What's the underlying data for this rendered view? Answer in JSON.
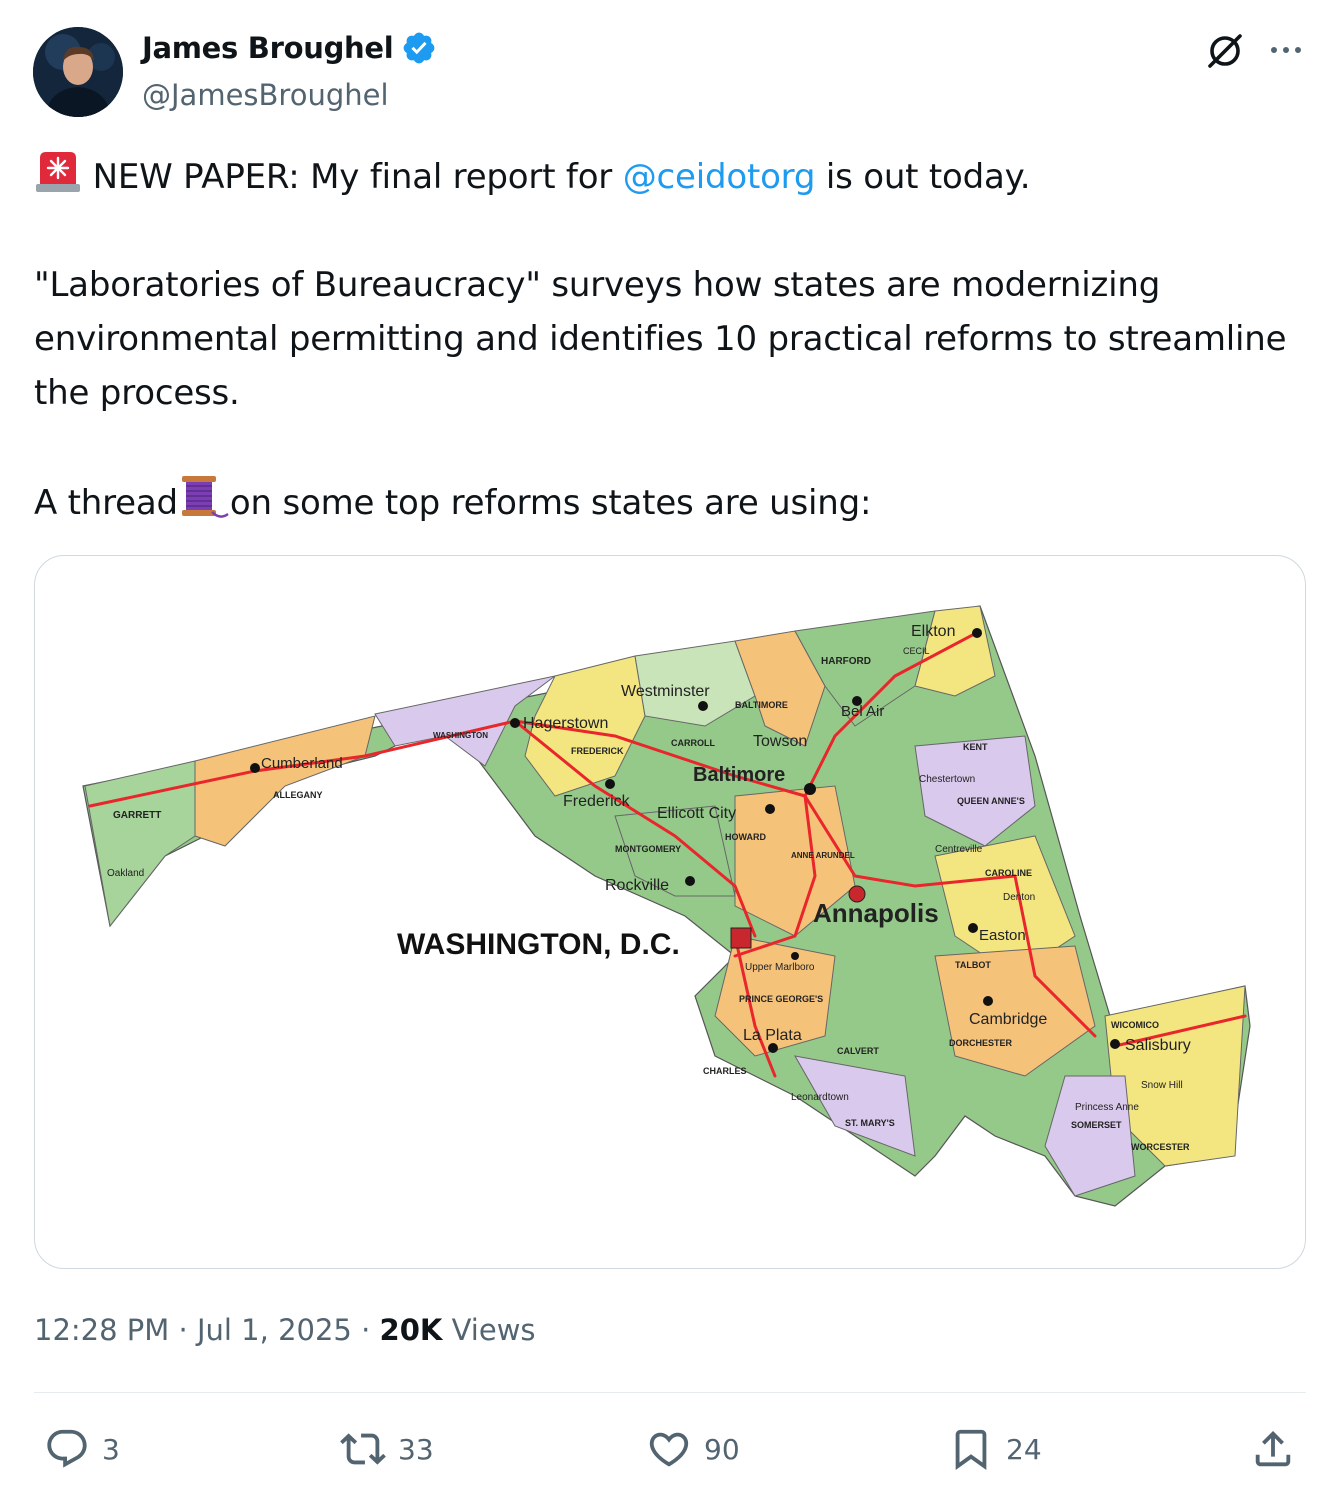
{
  "author": {
    "name": "James Broughel",
    "handle": "@JamesBroughel",
    "verified": true
  },
  "tweet": {
    "line1_pre": " NEW PAPER: My final report for ",
    "mention": "@ceidotorg",
    "line1_post": " is out today.",
    "para2": "\"Laboratories of Bureaucracy\" surveys how states are modernizing environmental permitting and identifies 10 practical reforms to streamline the process.",
    "para3_pre": "A thread",
    "para3_post": "on some top reforms states are using:"
  },
  "map": {
    "dc_label": "WASHINGTON, D.C.",
    "cities": {
      "elkton": "Elkton",
      "cecil": "CECIL",
      "harford": "HARFORD",
      "westminster": "Westminster",
      "baltimore_county": "BALTIMORE",
      "bel_air": "Bel Air",
      "hagerstown": "Hagerstown",
      "washington_county": "WASHINGTON",
      "frederick_county": "FREDERICK",
      "carroll": "CARROLL",
      "towson": "Towson",
      "kent": "KENT",
      "cumberland": "Cumberland",
      "baltimore": "Baltimore",
      "chestertown": "Chestertown",
      "allegany": "ALLEGANY",
      "frederick": "Frederick",
      "ellicott_city": "Ellicott City",
      "queen_annes": "QUEEN ANNE'S",
      "garrett": "GARRETT",
      "howard": "HOWARD",
      "montgomery": "MONTGOMERY",
      "centreville": "Centreville",
      "anne_arundel": "ANNE ARUNDEL",
      "caroline": "CAROLINE",
      "oakland": "Oakland",
      "denton": "Denton",
      "rockville": "Rockville",
      "annapolis": "Annapolis",
      "easton": "Easton",
      "upper_marlboro": "Upper Marlboro",
      "talbot": "TALBOT",
      "prince_georges": "PRINCE GEORGE'S",
      "cambridge": "Cambridge",
      "wicomico": "WICOMICO",
      "la_plata": "La Plata",
      "dorchester": "DORCHESTER",
      "salisbury": "Salisbury",
      "calvert": "CALVERT",
      "charles": "CHARLES",
      "snow_hill": "Snow Hill",
      "leonardtown": "Leonardtown",
      "princess_anne": "Princess Anne",
      "st_marys": "ST. MARY'S",
      "somerset": "SOMERSET",
      "worcester": "WORCESTER"
    }
  },
  "meta": {
    "time": "12:28 PM",
    "sep1": " · ",
    "date": "Jul 1, 2025",
    "sep2": " · ",
    "views_count": "20K",
    "views_label": " Views"
  },
  "actions": {
    "replies": "3",
    "reposts": "33",
    "likes": "90",
    "bookmarks": "24"
  },
  "icons": [
    "avatar",
    "verified-badge-icon",
    "grok-icon",
    "more-icon",
    "rotating-light-icon",
    "thread-spool-icon",
    "reply-icon",
    "repost-icon",
    "like-icon",
    "bookmark-icon",
    "share-icon"
  ],
  "colors": {
    "accent": "#1d9bf0",
    "text": "#0f1419",
    "muted": "#536471",
    "map_road": "#e8262b",
    "map_green": "#95c98a",
    "map_orange": "#f5c27a",
    "map_purple": "#d9c9ec",
    "map_yellow": "#f3e680"
  }
}
